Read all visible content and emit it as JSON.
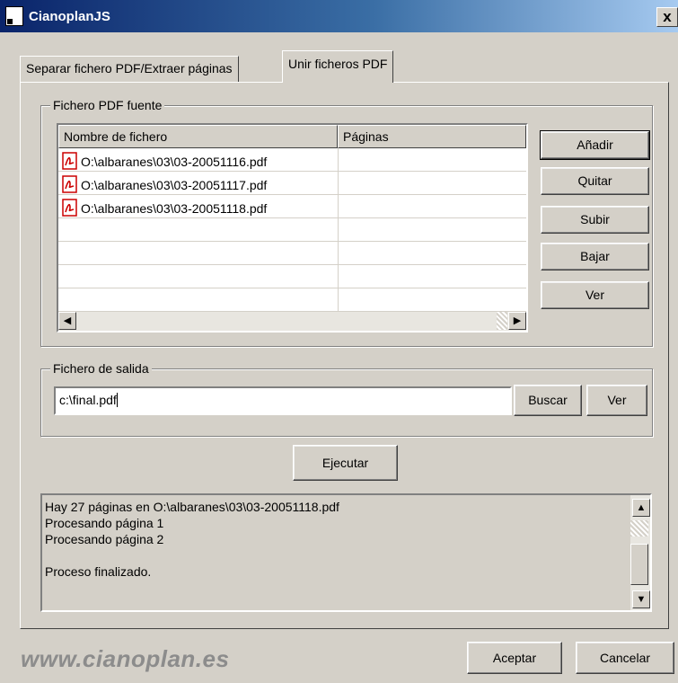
{
  "window": {
    "title": "CianoplanJS",
    "close_label": "x"
  },
  "tabs": [
    {
      "label": "Separar fichero PDF/Extraer páginas",
      "active": false
    },
    {
      "label": "Unir ficheros PDF",
      "active": true
    }
  ],
  "source_group": {
    "legend": "Fichero PDF fuente",
    "columns": [
      "Nombre de fichero",
      "Páginas"
    ],
    "rows": [
      {
        "file": "O:\\albaranes\\03\\03-20051116.pdf",
        "pages": ""
      },
      {
        "file": "O:\\albaranes\\03\\03-20051117.pdf",
        "pages": ""
      },
      {
        "file": "O:\\albaranes\\03\\03-20051118.pdf",
        "pages": ""
      }
    ],
    "file_icon": "pdf-file-icon",
    "buttons": {
      "add": "Añadir",
      "remove": "Quitar",
      "up": "Subir",
      "down": "Bajar",
      "view": "Ver"
    }
  },
  "output_group": {
    "legend": "Fichero de salida",
    "value": "c:\\final.pdf",
    "browse_label": "Buscar",
    "view_label": "Ver"
  },
  "execute_label": "Ejecutar",
  "log": [
    "Hay 27 páginas en O:\\albaranes\\03\\03-20051118.pdf",
    "Procesando página 1",
    "Procesando página 2",
    "",
    "Proceso finalizado."
  ],
  "footer": {
    "website": "www.cianoplan.es",
    "ok_label": "Aceptar",
    "cancel_label": "Cancelar"
  },
  "colors": {
    "title_bar_start": "#0a246a",
    "title_bar_end": "#a6caf0",
    "face": "#d4d0c8",
    "pdf_icon": "#cc0000"
  }
}
